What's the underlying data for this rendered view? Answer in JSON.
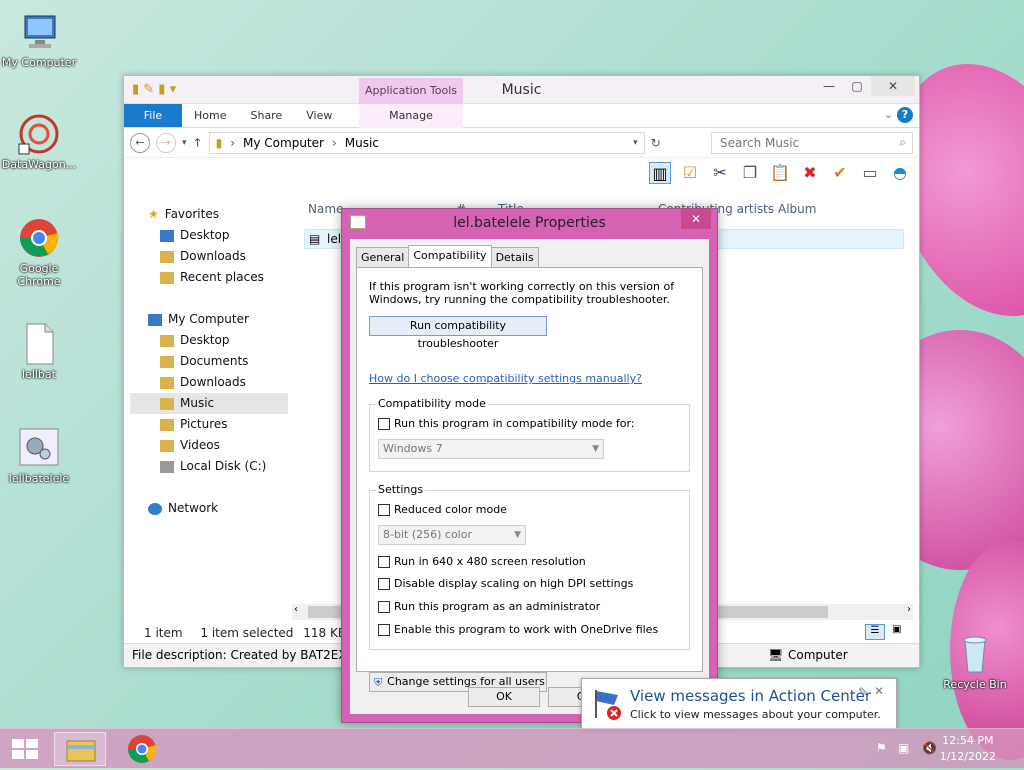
{
  "desktop": {
    "icons": [
      {
        "label": "My Computer",
        "icon": "computer-icon"
      },
      {
        "label": "DataWagon...",
        "icon": "datawagon-icon"
      },
      {
        "label": "Google Chrome",
        "icon": "chrome-icon"
      },
      {
        "label": "lellbat",
        "icon": "file-icon"
      },
      {
        "label": "lellbatelele",
        "icon": "settings-file-icon"
      },
      {
        "label": "Recycle Bin",
        "icon": "recycle-bin-icon"
      }
    ]
  },
  "explorer": {
    "title": "Music",
    "context_tab": "Application Tools",
    "ribbon": {
      "file": "File",
      "home": "Home",
      "share": "Share",
      "view": "View",
      "manage": "Manage"
    },
    "address": {
      "part1": "My Computer",
      "part2": "Music"
    },
    "search_placeholder": "Search Music",
    "columns": {
      "name": "Name",
      "num": "#",
      "title": "Title",
      "artists": "Contributing artists",
      "album": "Album"
    },
    "file_name": "lel",
    "nav": {
      "favorites": "Favorites",
      "fav_items": [
        "Desktop",
        "Downloads",
        "Recent places"
      ],
      "mycomputer": "My Computer",
      "pc_items": [
        "Desktop",
        "Documents",
        "Downloads",
        "Music",
        "Pictures",
        "Videos",
        "Local Disk (C:)"
      ],
      "network": "Network"
    },
    "status": {
      "count": "1 item",
      "selected": "1 item selected",
      "size": "118 KB"
    },
    "description": "File description: Created by BAT2EXE.ne",
    "computer_label": "Computer"
  },
  "dialog": {
    "title": "lel.batelele Properties",
    "tabs": [
      "General",
      "Compatibility",
      "Details"
    ],
    "intro": "If this program isn't working correctly on this version of Windows, try running the compatibility troubleshooter.",
    "run_button": "Run compatibility troubleshooter",
    "link": "How do I choose compatibility settings manually?",
    "compat_group": "Compatibility mode",
    "compat_check": "Run this program in compatibility mode for:",
    "compat_value": "Windows 7",
    "settings_group": "Settings",
    "reduced_color": "Reduced color mode",
    "color_value": "8-bit (256) color",
    "res_640": "Run in 640 x 480 screen resolution",
    "dpi": "Disable display scaling on high DPI settings",
    "admin": "Run this program as an administrator",
    "onedrive": "Enable this program to work with OneDrive files",
    "change_all": "Change settings for all users",
    "ok": "OK",
    "cancel": "Ca"
  },
  "toast": {
    "title": "View messages in Action Center",
    "message": "Click to view messages about your computer."
  },
  "taskbar": {
    "time": "12:54 PM",
    "date": "1/12/2022"
  }
}
